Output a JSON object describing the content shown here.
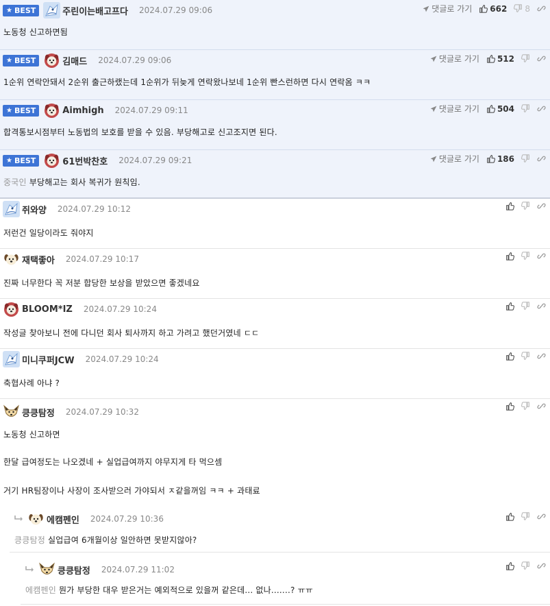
{
  "labels": {
    "best": "BEST",
    "reply_link": "댓글로 가기"
  },
  "best_comments": [
    {
      "nick": "주린이는배고프다",
      "date": "2024.07.29 09:06",
      "text": "노동청 신고하면됨",
      "likes": "662",
      "dislikes": "8",
      "avatar": "bird"
    },
    {
      "nick": "김매드",
      "date": "2024.07.29 09:06",
      "text": "1순위 연락안돼서 2순위 출근하랬는데 1순위가 뒤늦게 연락왔나보네 1순위 빤스런하면 다시 연락옴 ㅋㅋ",
      "likes": "512",
      "avatar": "dog-red"
    },
    {
      "nick": "Aimhigh",
      "date": "2024.07.29 09:11",
      "text": "합격통보시점부터 노동법의 보호를 받을 수 있음. 부당해고로 신고조지면 된다.",
      "likes": "504",
      "avatar": "dog-red"
    },
    {
      "nick": "61번박찬호",
      "date": "2024.07.29 09:21",
      "mention": "중국인",
      "text": "부당해고는 회사 복귀가 원칙임.",
      "likes": "186",
      "avatar": "dog-red"
    }
  ],
  "comments": [
    {
      "nick": "쥐와양",
      "date": "2024.07.29 10:12",
      "text": "저런건 일당이라도 줘야지",
      "avatar": "bird"
    },
    {
      "nick": "재택좋아",
      "date": "2024.07.29 10:17",
      "text": "진짜 너무한다 꼭 저분 합당한 보상을 받았으면 좋겠네요",
      "avatar": "dog-plain"
    },
    {
      "nick": "BLOOM*IZ",
      "date": "2024.07.29 10:24",
      "text": "작성글 찾아보니 전에 다니던 회사 퇴사까지 하고 가려고 했던거였네 ㄷㄷ",
      "avatar": "dog-red"
    },
    {
      "nick": "미니쿠퍼JCW",
      "date": "2024.07.29 10:24",
      "text": "축협사례 아냐 ?",
      "avatar": "bird"
    },
    {
      "nick": "킁킁탐정",
      "date": "2024.07.29 10:32",
      "lines": [
        "노동청 신고하면",
        "한달 급여정도는 나오겠네 + 실업급여까지 야무지게 타 먹으셈",
        "거기 HR팀장이나 사장이 조사받으러 가야되서 ㅈ같을꺼임 ㅋㅋ + 과태료"
      ],
      "avatar": "fox"
    }
  ],
  "replies": [
    {
      "nick": "에캠펜인",
      "date": "2024.07.29 10:36",
      "mention": "킁킁탐정",
      "text": "실업급여 6개월이상 일안하면 못받지않아?",
      "avatar": "dog-plain"
    },
    {
      "nick": "킁킁탐정",
      "date": "2024.07.29 11:02",
      "mention": "에캠펜인",
      "text": "뭔가 부당한 대우 받은거는 예외적으로 있을꺼 같은데... 없나.......? ㅠㅠ",
      "avatar": "fox"
    }
  ]
}
